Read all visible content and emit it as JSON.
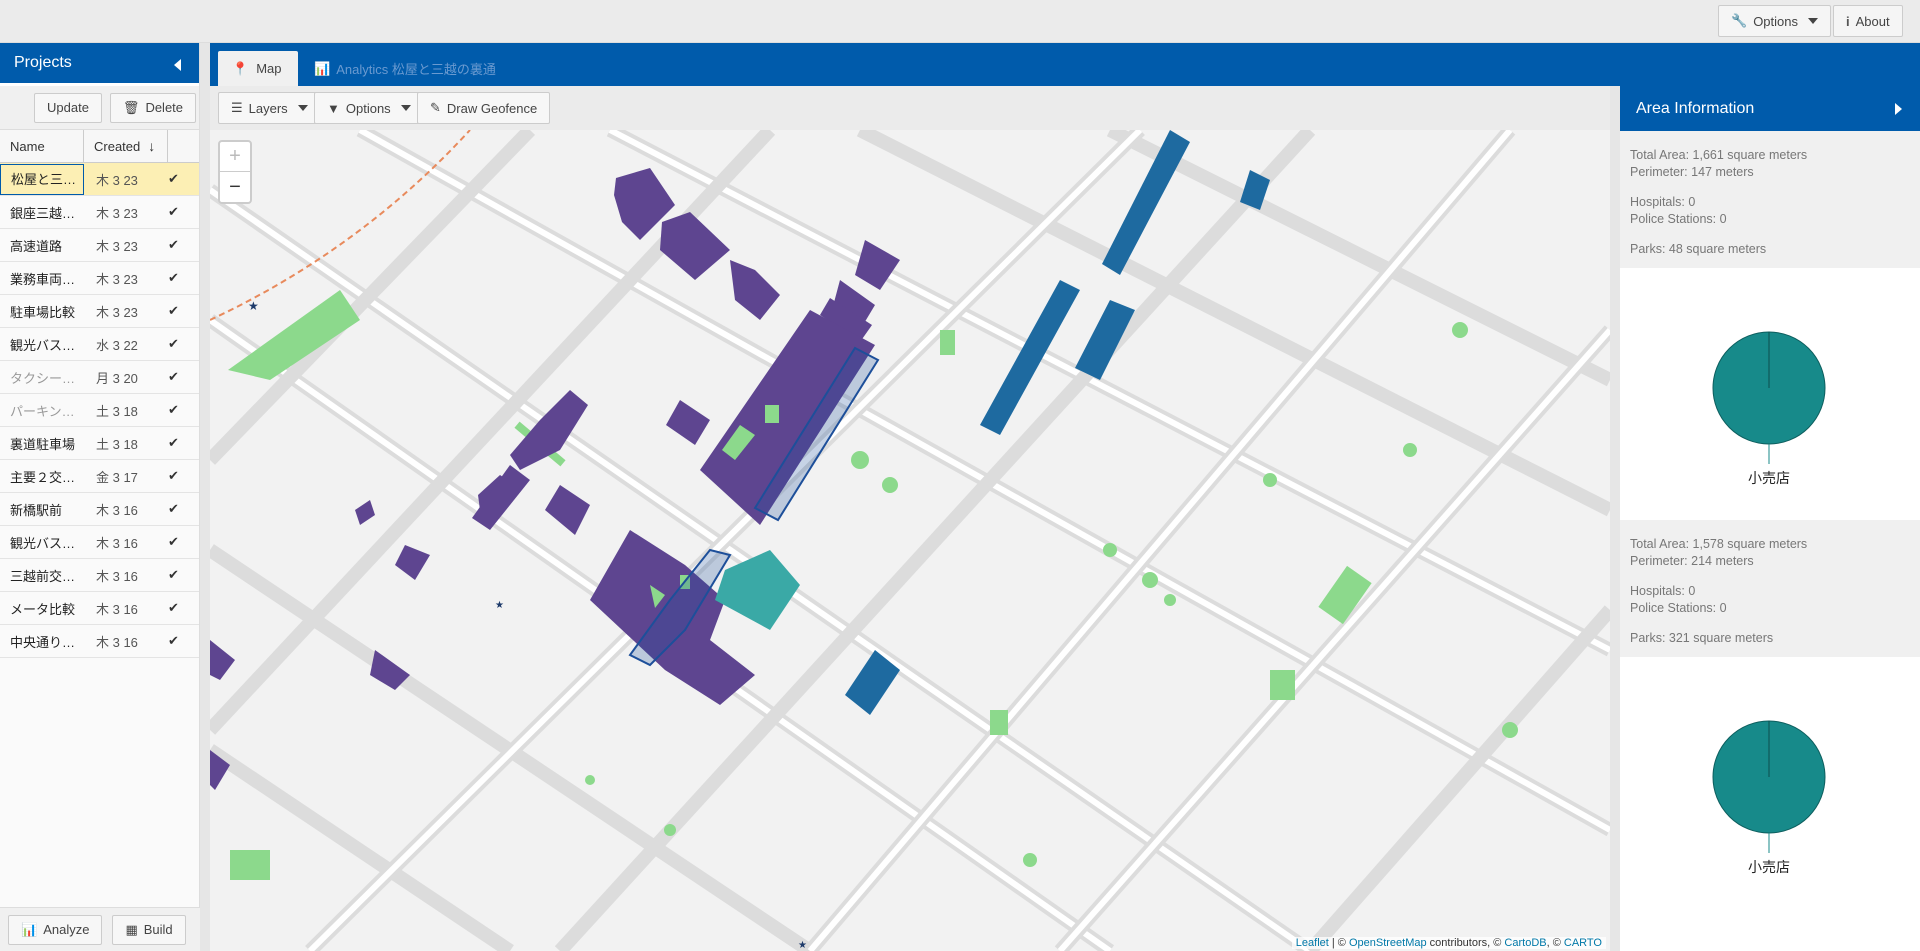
{
  "topbar": {
    "options_label": "Options",
    "about_label": "About"
  },
  "projects": {
    "title": "Projects",
    "update_label": "Update",
    "delete_label": "Delete",
    "col_name": "Name",
    "col_created": "Created",
    "rows": [
      {
        "name": "松屋と三…",
        "date": "木 3 23",
        "selected": true,
        "dim": false
      },
      {
        "name": "銀座三越…",
        "date": "木 3 23",
        "dim": false
      },
      {
        "name": "高速道路",
        "date": "木 3 23",
        "dim": false
      },
      {
        "name": "業務車両…",
        "date": "木 3 23",
        "dim": false
      },
      {
        "name": "駐車場比較",
        "date": "木 3 23",
        "dim": false
      },
      {
        "name": "観光バス…",
        "date": "水 3 22",
        "dim": false
      },
      {
        "name": "タクシー…",
        "date": "月 3 20",
        "dim": true
      },
      {
        "name": "パーキン…",
        "date": "土 3 18",
        "dim": true
      },
      {
        "name": "裏道駐車場",
        "date": "土 3 18",
        "dim": false
      },
      {
        "name": "主要２交…",
        "date": "金 3 17",
        "dim": false
      },
      {
        "name": "新橋駅前",
        "date": "木 3 16",
        "dim": false
      },
      {
        "name": "観光バス…",
        "date": "木 3 16",
        "dim": false
      },
      {
        "name": "三越前交…",
        "date": "木 3 16",
        "dim": false
      },
      {
        "name": "メータ比較",
        "date": "木 3 16",
        "dim": false
      },
      {
        "name": "中央通り…",
        "date": "木 3 16",
        "dim": false
      }
    ],
    "analyze_label": "Analyze",
    "build_label": "Build"
  },
  "tabs": {
    "map_label": "Map",
    "analytics_label": "Analytics 松屋と三越の裏通"
  },
  "map_toolbar": {
    "layers_label": "Layers",
    "options_label": "Options",
    "geofence_label": "Draw Geofence"
  },
  "map": {
    "zoom_in": "+",
    "zoom_out": "−",
    "attribution": {
      "leaflet": "Leaflet",
      "sep1": " | © ",
      "osm": "OpenStreetMap",
      "contrib": " contributors, © ",
      "cartodb": "CartoDB",
      "sep2": ", © ",
      "carto": "CARTO"
    },
    "colors": {
      "building": "#5e4590",
      "park": "#8cd98c",
      "geofence": "#1d4f9a",
      "teal": "#3aa9a6",
      "blue_building": "#1e6aa0"
    }
  },
  "area_info": {
    "title": "Area Information",
    "areas": [
      {
        "total_area": "Total Area: 1,661 square meters",
        "perimeter": "Perimeter: 147 meters",
        "hospitals": "Hospitals: 0",
        "police": "Police Stations: 0",
        "parks": "Parks: 48 square meters",
        "pie_label": "小売店",
        "pie_color": "#178a8a"
      },
      {
        "total_area": "Total Area: 1,578 square meters",
        "perimeter": "Perimeter: 214 meters",
        "hospitals": "Hospitals: 0",
        "police": "Police Stations: 0",
        "parks": "Parks: 321 square meters",
        "pie_label": "小売店",
        "pie_color": "#178a8a"
      }
    ]
  }
}
